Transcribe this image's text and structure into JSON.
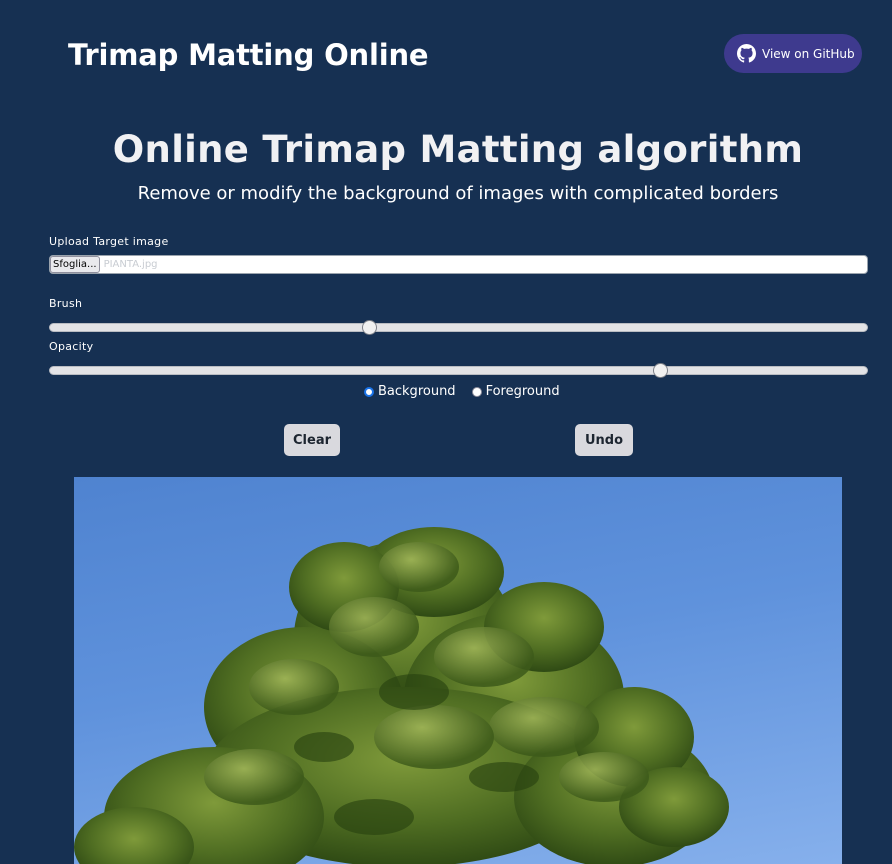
{
  "header": {
    "site_title": "Trimap Matting Online",
    "github_label": "View on GitHub"
  },
  "hero": {
    "title": "Online Trimap Matting algorithm",
    "subtitle": "Remove or modify the background of images with complicated borders"
  },
  "upload": {
    "label": "Upload Target image",
    "button_label": "Sfoglia...",
    "file_name": "PIANTA.jpg"
  },
  "brush": {
    "label": "Brush",
    "value_fraction": 0.39
  },
  "opacity": {
    "label": "Opacity",
    "value_fraction": 0.745
  },
  "mode": {
    "options": [
      "Background",
      "Foreground"
    ],
    "selected": "Background"
  },
  "actions": {
    "clear_label": "Clear",
    "undo_label": "Undo"
  },
  "canvas": {
    "image_subject": "tree-photo"
  },
  "icons": {
    "github": "github-icon"
  },
  "colors": {
    "page_bg": "#163052",
    "github_button": "#3e3a8e",
    "action_button": "#d9d9de"
  }
}
